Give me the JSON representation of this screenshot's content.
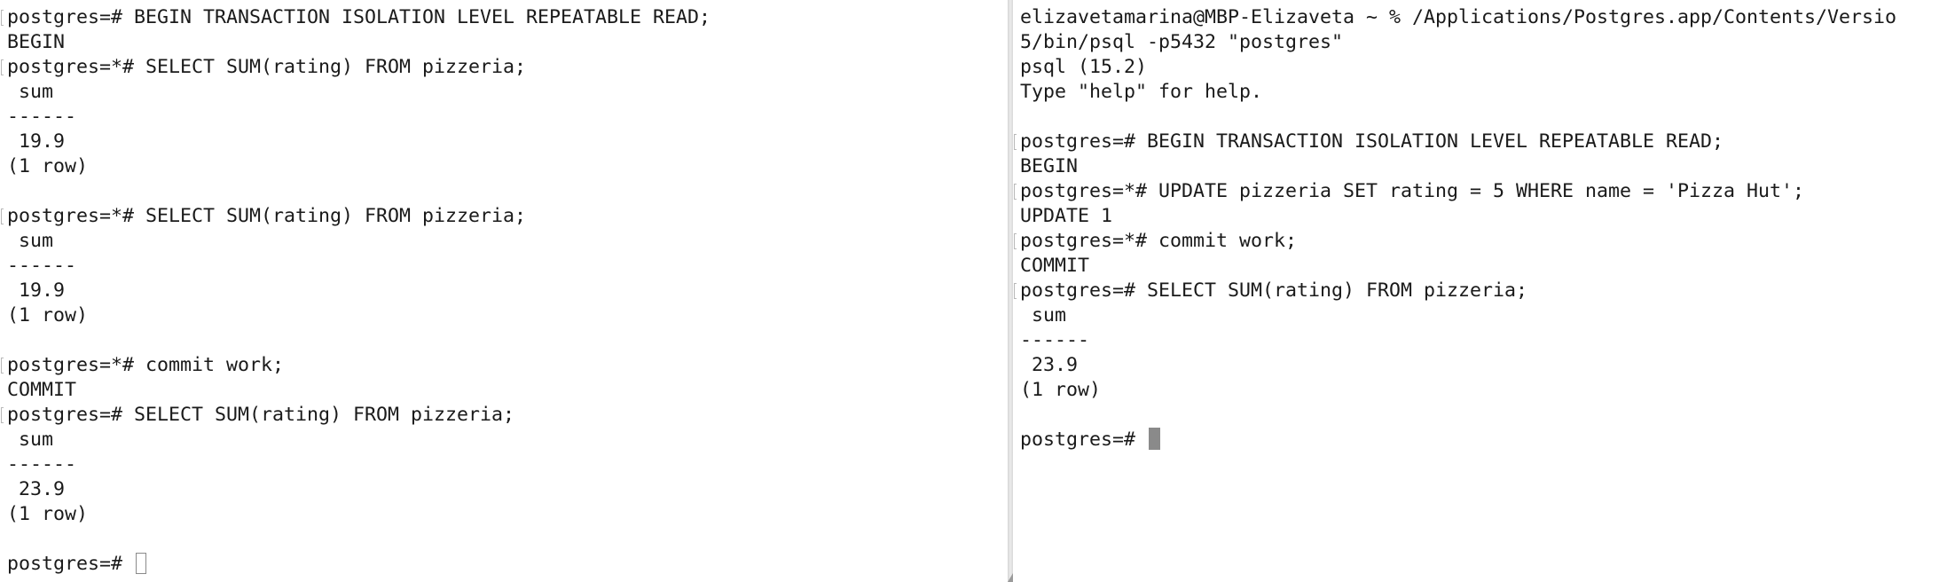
{
  "left_terminal": {
    "lines": [
      "postgres=# BEGIN TRANSACTION ISOLATION LEVEL REPEATABLE READ;",
      "BEGIN",
      "postgres=*# SELECT SUM(rating) FROM pizzeria;",
      " sum",
      "------",
      " 19.9",
      "(1 row)",
      "",
      "postgres=*# SELECT SUM(rating) FROM pizzeria;",
      " sum",
      "------",
      " 19.9",
      "(1 row)",
      "",
      "postgres=*# commit work;",
      "COMMIT",
      "postgres=# SELECT SUM(rating) FROM pizzeria;",
      " sum",
      "------",
      " 23.9",
      "(1 row)",
      "",
      "postgres=# "
    ],
    "cursor_style": "hollow"
  },
  "right_terminal": {
    "lines": [
      "elizavetamarina@MBP-Elizaveta ~ % /Applications/Postgres.app/Contents/Versio",
      "5/bin/psql -p5432 \"postgres\"",
      "psql (15.2)",
      "Type \"help\" for help.",
      "",
      "postgres=# BEGIN TRANSACTION ISOLATION LEVEL REPEATABLE READ;",
      "BEGIN",
      "postgres=*# UPDATE pizzeria SET rating = 5 WHERE name = 'Pizza Hut';",
      "UPDATE 1",
      "postgres=*# commit work;",
      "COMMIT",
      "postgres=# SELECT SUM(rating) FROM pizzeria;",
      " sum",
      "------",
      " 23.9",
      "(1 row)",
      "",
      "postgres=# "
    ],
    "cursor_style": "solid"
  },
  "colors": {
    "text": "#1a1a1a",
    "background": "#ffffff",
    "cursor": "#8a8a8a",
    "divider": "#d8d8d8"
  }
}
